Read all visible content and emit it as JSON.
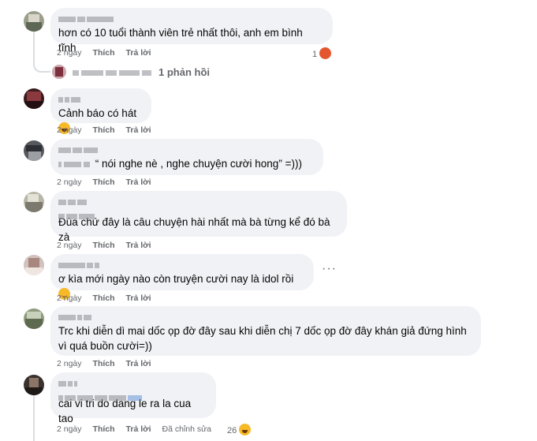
{
  "comments": [
    {
      "text": "hơn có 10 tuổi thành viên trẻ nhất thôi, anh em bình tĩnh",
      "time": "2 ngày",
      "like": "Thích",
      "reply": "Trả lời",
      "reaction_count": "1",
      "reaction_icon": "angry-emoji",
      "replies_label": "1 phản hồi"
    },
    {
      "text": "Cảnh báo có hát",
      "time": "2 ngày",
      "like": "Thích",
      "reply": "Trả lời"
    },
    {
      "text": "“ nói nghe nè , nghe chuyện cười hong” =)))",
      "time": "2 ngày",
      "like": "Thích",
      "reply": "Trả lời"
    },
    {
      "text": "Đùa chứ đây là câu chuyện hài nhất mà bà từng kể đó bà zà",
      "time": "2 ngày",
      "like": "Thích",
      "reply": "Trả lời"
    },
    {
      "text": "ơ kìa mới ngày nào còn truyện cười nay là idol rồi",
      "time": "2 ngày",
      "like": "Thích",
      "reply": "Trả lời",
      "more": "···"
    },
    {
      "text": "Trc khi diễn dì mai dốc ọp đờ đây sau khi diễn chị 7 dốc ọp đờ đây khán giả đứng hình vì quá buồn cười=))",
      "time": "2 ngày",
      "like": "Thích",
      "reply": "Trả lời"
    },
    {
      "text": "cai vi tri do dang le ra la cua tao",
      "time": "2 ngày",
      "like": "Thích",
      "reply": "Trả lời",
      "edited": "Đã chỉnh sửa",
      "reaction_count": "26",
      "reaction_icon": "laugh-emoji"
    }
  ],
  "colors": {
    "bubble": "#f0f2f5",
    "meta_text": "#65676b",
    "text": "#050505",
    "thread_line": "#dadde1"
  }
}
